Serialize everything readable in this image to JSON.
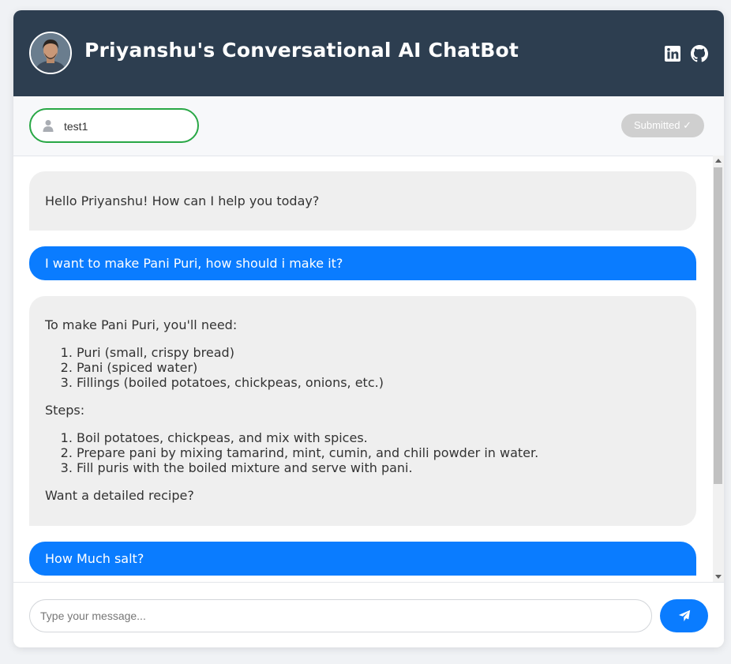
{
  "header": {
    "title": "Priyanshu's Conversational AI ChatBot",
    "avatar": "avatar-photo",
    "icons": [
      "linkedin-icon",
      "github-icon"
    ],
    "background": "#2d3e50"
  },
  "user_bar": {
    "username_value": "test1",
    "username_icon": "user-icon",
    "submit_label": "Submitted ✓",
    "field_border_color": "#28a745"
  },
  "messages": [
    {
      "role": "bot",
      "text": "Hello Priyanshu! How can I help you today?"
    },
    {
      "role": "user",
      "text": "I want to make Pani Puri, how should i make it?"
    },
    {
      "role": "bot",
      "intro": "To make Pani Puri, you'll need:",
      "ingredients": [
        "Puri (small, crispy bread)",
        "Pani (spiced water)",
        "Fillings (boiled potatoes, chickpeas, onions, etc.)"
      ],
      "steps_label": "Steps:",
      "steps": [
        "Boil potatoes, chickpeas, and mix with spices.",
        "Prepare pani by mixing tamarind, mint, cumin, and chili powder in water.",
        "Fill puris with the boiled mixture and serve with pani."
      ],
      "outro": "Want a detailed recipe?"
    },
    {
      "role": "user",
      "text": "How Much salt?"
    }
  ],
  "composer": {
    "placeholder": "Type your message...",
    "send_icon": "paper-plane-icon",
    "accent": "#0a7cff"
  }
}
